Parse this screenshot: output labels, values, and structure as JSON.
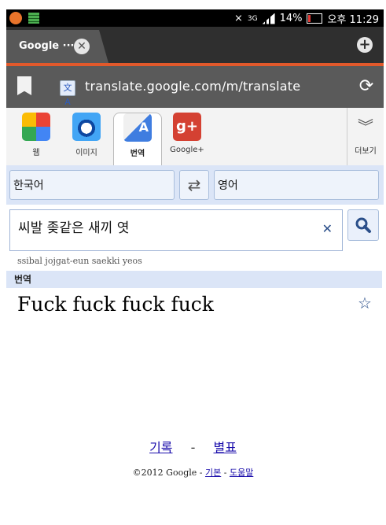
{
  "status_bar": {
    "network": "3G",
    "battery": "14%",
    "time": "오후 11:29"
  },
  "browser": {
    "tab_title": "Google ···",
    "url": "translate.google.com/m/translate"
  },
  "apps": {
    "items": [
      {
        "label": "웹",
        "icon": "google-search-icon",
        "color": "#4285f4"
      },
      {
        "label": "이미지",
        "icon": "camera-icon",
        "color": "#1e88e5"
      },
      {
        "label": "번역",
        "icon": "translate-icon",
        "color": "#3f7de0"
      },
      {
        "label": "Google+",
        "icon": "google-plus-icon",
        "color": "#d44132"
      }
    ],
    "more_label": "더보기"
  },
  "languages": {
    "source": "한국어",
    "target": "영어"
  },
  "input": {
    "text": "씨발 좆같은 새끼 엿",
    "transliteration": "ssibal jojgat-eun saekki yeos"
  },
  "result": {
    "header": "번역",
    "text": "Fuck fuck fuck fuck"
  },
  "links": {
    "history": "기록",
    "separator": "-",
    "starred": "별표"
  },
  "footer": {
    "copyright": "©2012 Google",
    "sep1": " - ",
    "basic": "기본",
    "sep2": " - ",
    "help": "도움말"
  }
}
